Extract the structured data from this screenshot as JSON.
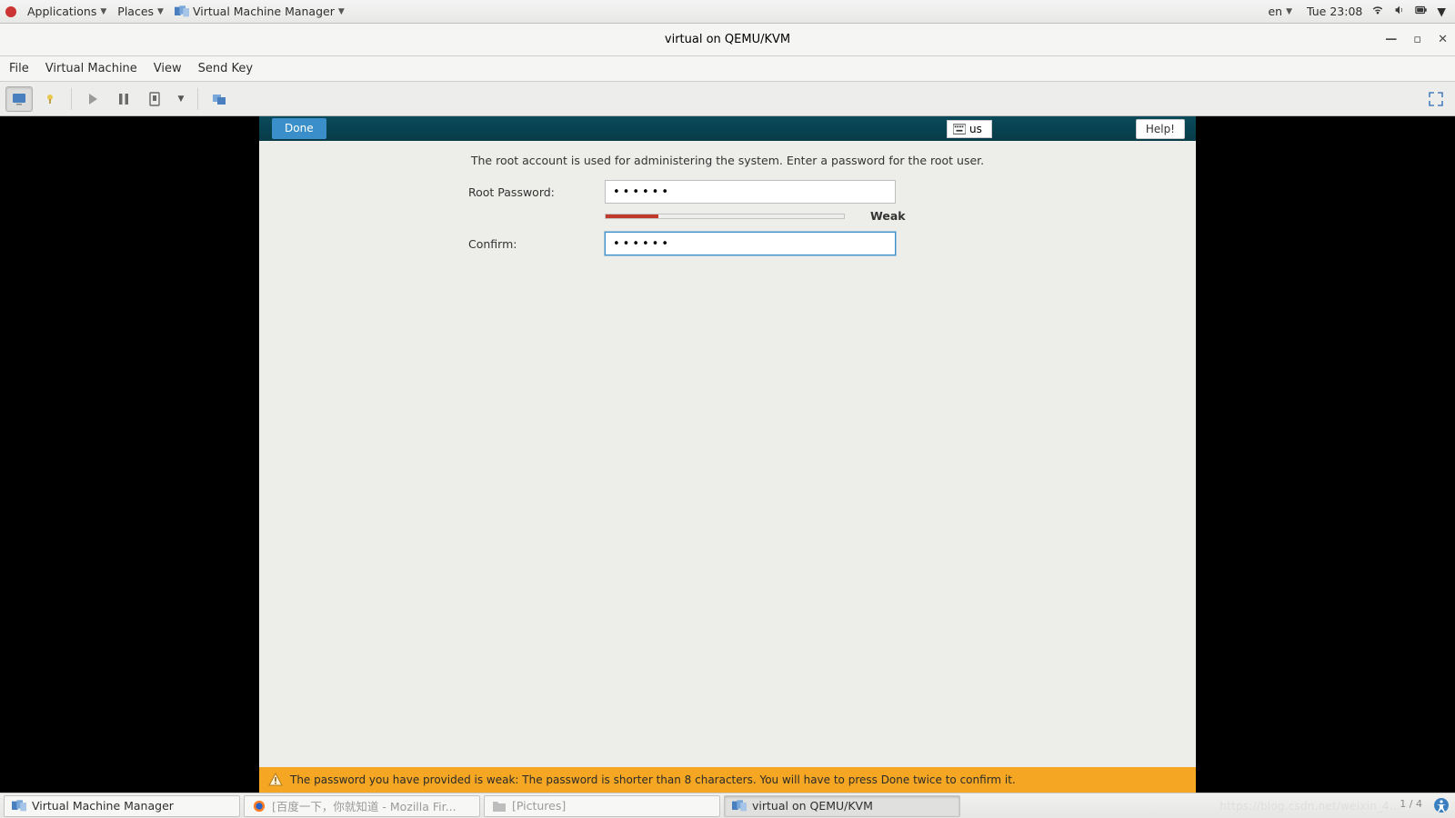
{
  "gnome": {
    "applications": "Applications",
    "places": "Places",
    "active_app": "Virtual Machine Manager",
    "lang": "en",
    "clock": "Tue 23:08"
  },
  "vmm": {
    "title": "virtual on QEMU/KVM",
    "menus": {
      "file": "File",
      "vm": "Virtual Machine",
      "view": "View",
      "sendkey": "Send Key"
    }
  },
  "anaconda": {
    "done": "Done",
    "kb_layout": "us",
    "help": "Help!",
    "instruction": "The root account is used for administering the system.   Enter a password for the root user.",
    "root_pw_label": "Root Password:",
    "confirm_label": "Confirm:",
    "root_pw_value": "••••••",
    "confirm_value": "••••••",
    "strength": "Weak",
    "warning": "The password you have provided is weak: The password is shorter than 8 characters. You will have to press Done twice to confirm it."
  },
  "taskbar": {
    "items": [
      {
        "label": "Virtual Machine Manager",
        "icon": "vmm",
        "active": false,
        "muted": false
      },
      {
        "label": "[百度一下，你就知道 - Mozilla Fir...",
        "icon": "firefox",
        "active": false,
        "muted": true
      },
      {
        "label": "[Pictures]",
        "icon": "folder",
        "active": false,
        "muted": true
      },
      {
        "label": "virtual on QEMU/KVM",
        "icon": "vmm",
        "active": true,
        "muted": false
      }
    ],
    "pager": "1 / 4"
  },
  "watermark": "https://blog.csdn.net/weixin_4..."
}
